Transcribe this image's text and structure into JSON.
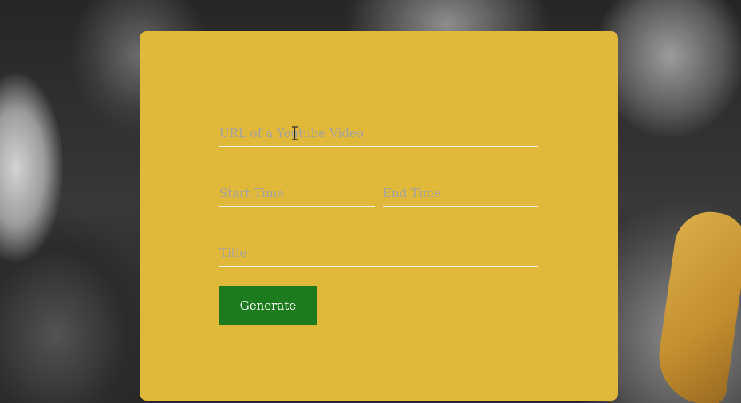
{
  "form": {
    "url_placeholder": "URL of a Youtube Video",
    "start_time_placeholder": "Start Time",
    "end_time_placeholder": "End Time",
    "title_placeholder": "Title",
    "generate_label": "Generate"
  },
  "colors": {
    "panel": "#e1b93a",
    "button": "#1b7b1d",
    "placeholder": "#a3a3a3",
    "underline": "#f6f2e6"
  },
  "icons": {
    "cursor": "text-cursor-icon"
  }
}
